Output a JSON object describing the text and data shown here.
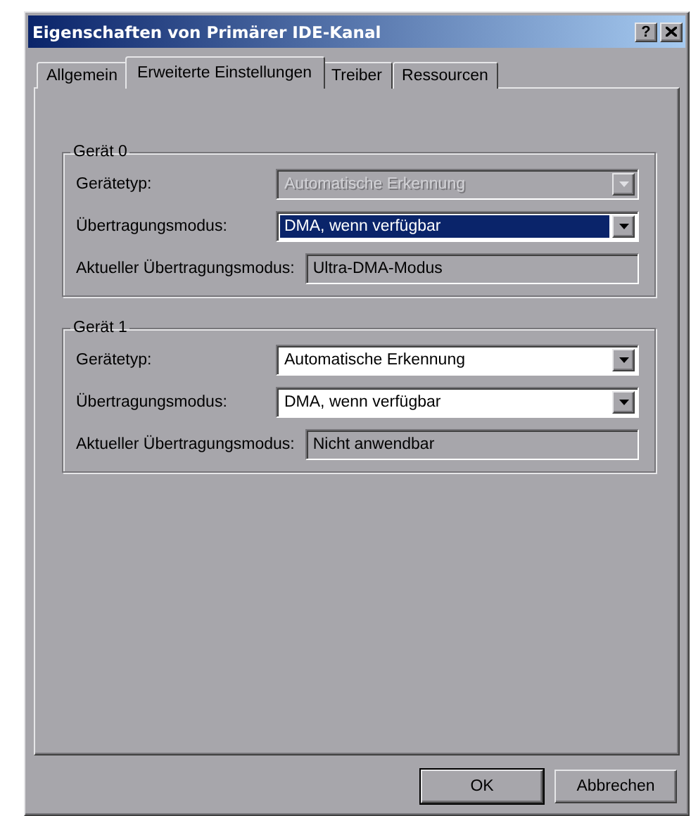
{
  "window": {
    "title": "Eigenschaften von Primärer IDE-Kanal",
    "help_button": "?"
  },
  "tabs": [
    {
      "label": "Allgemein",
      "selected": false
    },
    {
      "label": "Erweiterte Einstellungen",
      "selected": true
    },
    {
      "label": "Treiber",
      "selected": false
    },
    {
      "label": "Ressourcen",
      "selected": false
    }
  ],
  "groups": [
    {
      "title": "Gerät 0",
      "rows": [
        {
          "kind": "combo",
          "label": "Gerätetyp:",
          "value": "Automatische Erkennung",
          "disabled": true,
          "highlighted": false
        },
        {
          "kind": "combo",
          "label": "Übertragungsmodus:",
          "value": "DMA, wenn verfügbar",
          "disabled": false,
          "highlighted": true
        },
        {
          "kind": "readonly",
          "label": "Aktueller Übertragungsmodus:",
          "value": "Ultra-DMA-Modus"
        }
      ]
    },
    {
      "title": "Gerät 1",
      "rows": [
        {
          "kind": "combo",
          "label": "Gerätetyp:",
          "value": "Automatische Erkennung",
          "disabled": false,
          "highlighted": false
        },
        {
          "kind": "combo",
          "label": "Übertragungsmodus:",
          "value": "DMA, wenn verfügbar",
          "disabled": false,
          "highlighted": false
        },
        {
          "kind": "readonly",
          "label": "Aktueller Übertragungsmodus:",
          "value": "Nicht anwendbar"
        }
      ]
    }
  ],
  "buttons": [
    {
      "label": "OK",
      "default": true
    },
    {
      "label": "Abbrechen",
      "default": false
    }
  ]
}
